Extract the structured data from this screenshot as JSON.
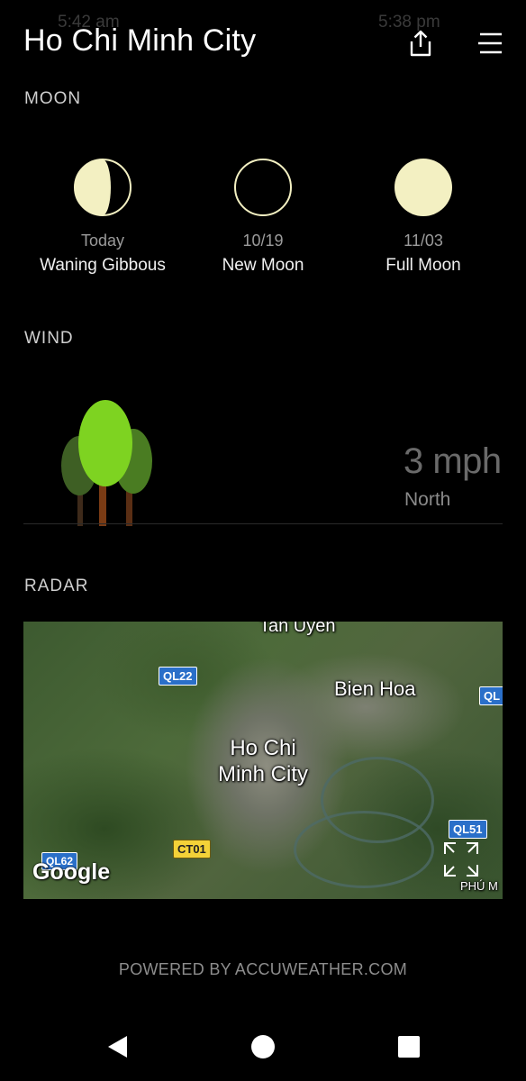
{
  "status_bar": {
    "time_left": "5:42 am",
    "time_right": "5:38 pm"
  },
  "header": {
    "title": "Ho Chi Minh City",
    "share_icon": "share-icon",
    "menu_icon": "menu-icon"
  },
  "moon": {
    "section_label": "MOON",
    "phases": [
      {
        "date": "Today",
        "name": "Waning Gibbous",
        "icon": "waning-gibbous-icon"
      },
      {
        "date": "10/19",
        "name": "New Moon",
        "icon": "new-moon-icon"
      },
      {
        "date": "11/03",
        "name": "Full Moon",
        "icon": "full-moon-icon"
      }
    ],
    "moon_color": "#f3f0c2"
  },
  "wind": {
    "section_label": "WIND",
    "speed": "3 mph",
    "direction": "North",
    "tree_colors": [
      "#7ed321",
      "#4a7c22",
      "#3e5f24"
    ]
  },
  "radar": {
    "section_label": "RADAR",
    "map_labels": {
      "tan_uyen": "Tan Uyen",
      "bien_hoa": "Bien Hoa",
      "city_line1": "Ho Chi",
      "city_line2": "Minh City",
      "phu_m": "PHÚ M"
    },
    "road_badges": {
      "ql22": "QL22",
      "ql_edge": "QL",
      "ql51": "QL51",
      "ql62": "QL62",
      "ct01": "CT01"
    },
    "google_logo": "Google",
    "expand_icon": "expand-icon"
  },
  "footer": {
    "powered_by": "POWERED BY ACCUWEATHER.COM"
  },
  "nav_bar": {
    "back_icon": "back-icon",
    "home_icon": "home-icon",
    "recents_icon": "recents-icon"
  }
}
